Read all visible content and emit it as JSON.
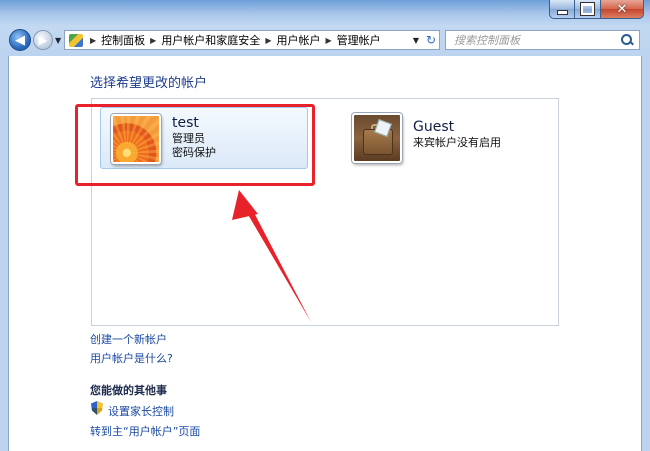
{
  "window": {
    "caption_buttons": {
      "minimize": "minimize-icon",
      "maximize": "maximize-icon",
      "close": "close-icon"
    }
  },
  "nav": {
    "back_icon": "arrow-left-icon",
    "forward_icon": "arrow-right-icon",
    "history_icon": "chevron-down-icon"
  },
  "address": {
    "icon": "control-panel-icon",
    "breadcrumbs": [
      "控制面板",
      "用户帐户和家庭安全",
      "用户帐户",
      "管理帐户"
    ],
    "dropdown_icon": "chevron-down-icon",
    "refresh_icon": "refresh-icon"
  },
  "search": {
    "placeholder": "搜索控制面板",
    "icon": "search-icon"
  },
  "main": {
    "title": "选择希望更改的帐户",
    "accounts": [
      {
        "name": "test",
        "role": "管理员",
        "status": "密码保护",
        "avatar": "flower-avatar",
        "selected": true
      },
      {
        "name": "Guest",
        "status": "来宾帐户没有启用",
        "avatar": "guest-briefcase-avatar",
        "selected": false
      }
    ],
    "links": {
      "create_account": "创建一个新帐户",
      "what_is_account": "用户帐户是什么?"
    },
    "other_things": {
      "heading": "您能做的其他事",
      "parental_controls": "设置家长控制",
      "goto_user_accounts": "转到主“用户帐户”页面",
      "shield_icon": "uac-shield-icon"
    }
  },
  "annotation": {
    "highlight_color": "#e8222b"
  }
}
